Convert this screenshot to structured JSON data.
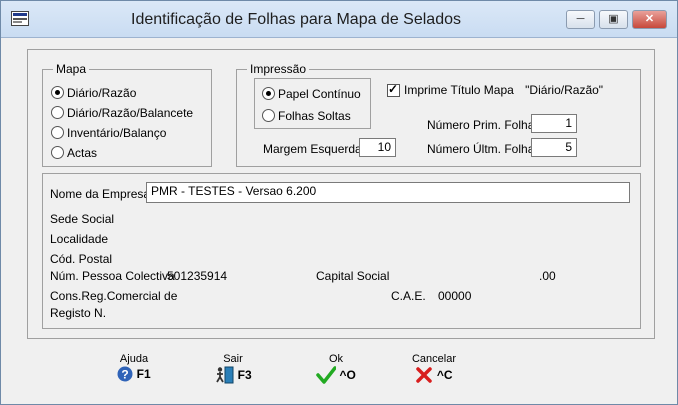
{
  "window": {
    "title": "Identificação de Folhas para Mapa de Selados"
  },
  "mapa": {
    "legend": "Mapa",
    "options": [
      "Diário/Razão",
      "Diário/Razão/Balancete",
      "Inventário/Balanço",
      "Actas"
    ],
    "selected": "Diário/Razão"
  },
  "impressao": {
    "legend": "Impressão",
    "options": [
      "Papel Contínuo",
      "Folhas Soltas"
    ],
    "selected": "Papel Contínuo",
    "imprime_titulo_label": "Imprime Título Mapa",
    "imprime_titulo_value": "\"Diário/Razão\"",
    "imprime_titulo_checked": true,
    "margem_label": "Margem Esquerda :",
    "margem_value": "10",
    "prim_folha_label": "Número Prim. Folha :",
    "prim_folha_value": "1",
    "ultm_folha_label": "Número Últm. Folha :",
    "ultm_folha_value": "5"
  },
  "empresa": {
    "nome_label": "Nome da Empresa :",
    "nome_value": "PMR - TESTES - Versao 6.200",
    "sede_label": "Sede Social",
    "localidade_label": "Localidade",
    "cod_postal_label": "Cód. Postal",
    "pessoa_colectiva_label": "Núm. Pessoa Colectiva",
    "pessoa_colectiva_value": "501235914",
    "capital_label": "Capital Social",
    "capital_value": ".00",
    "cons_reg_label": "Cons.Reg.Comercial de",
    "cae_label": "C.A.E.",
    "cae_value": "00000",
    "registo_label": "Registo N."
  },
  "footer": {
    "ajuda": {
      "caption": "Ajuda",
      "key": "F1"
    },
    "sair": {
      "caption": "Sair",
      "key": "F3"
    },
    "ok": {
      "caption": "Ok",
      "key": "^O"
    },
    "cancelar": {
      "caption": "Cancelar",
      "key": "^C"
    }
  },
  "colors": {
    "ok_green": "#22aa22",
    "cancel_red": "#d81e1e",
    "help_blue": "#2f63b8"
  }
}
